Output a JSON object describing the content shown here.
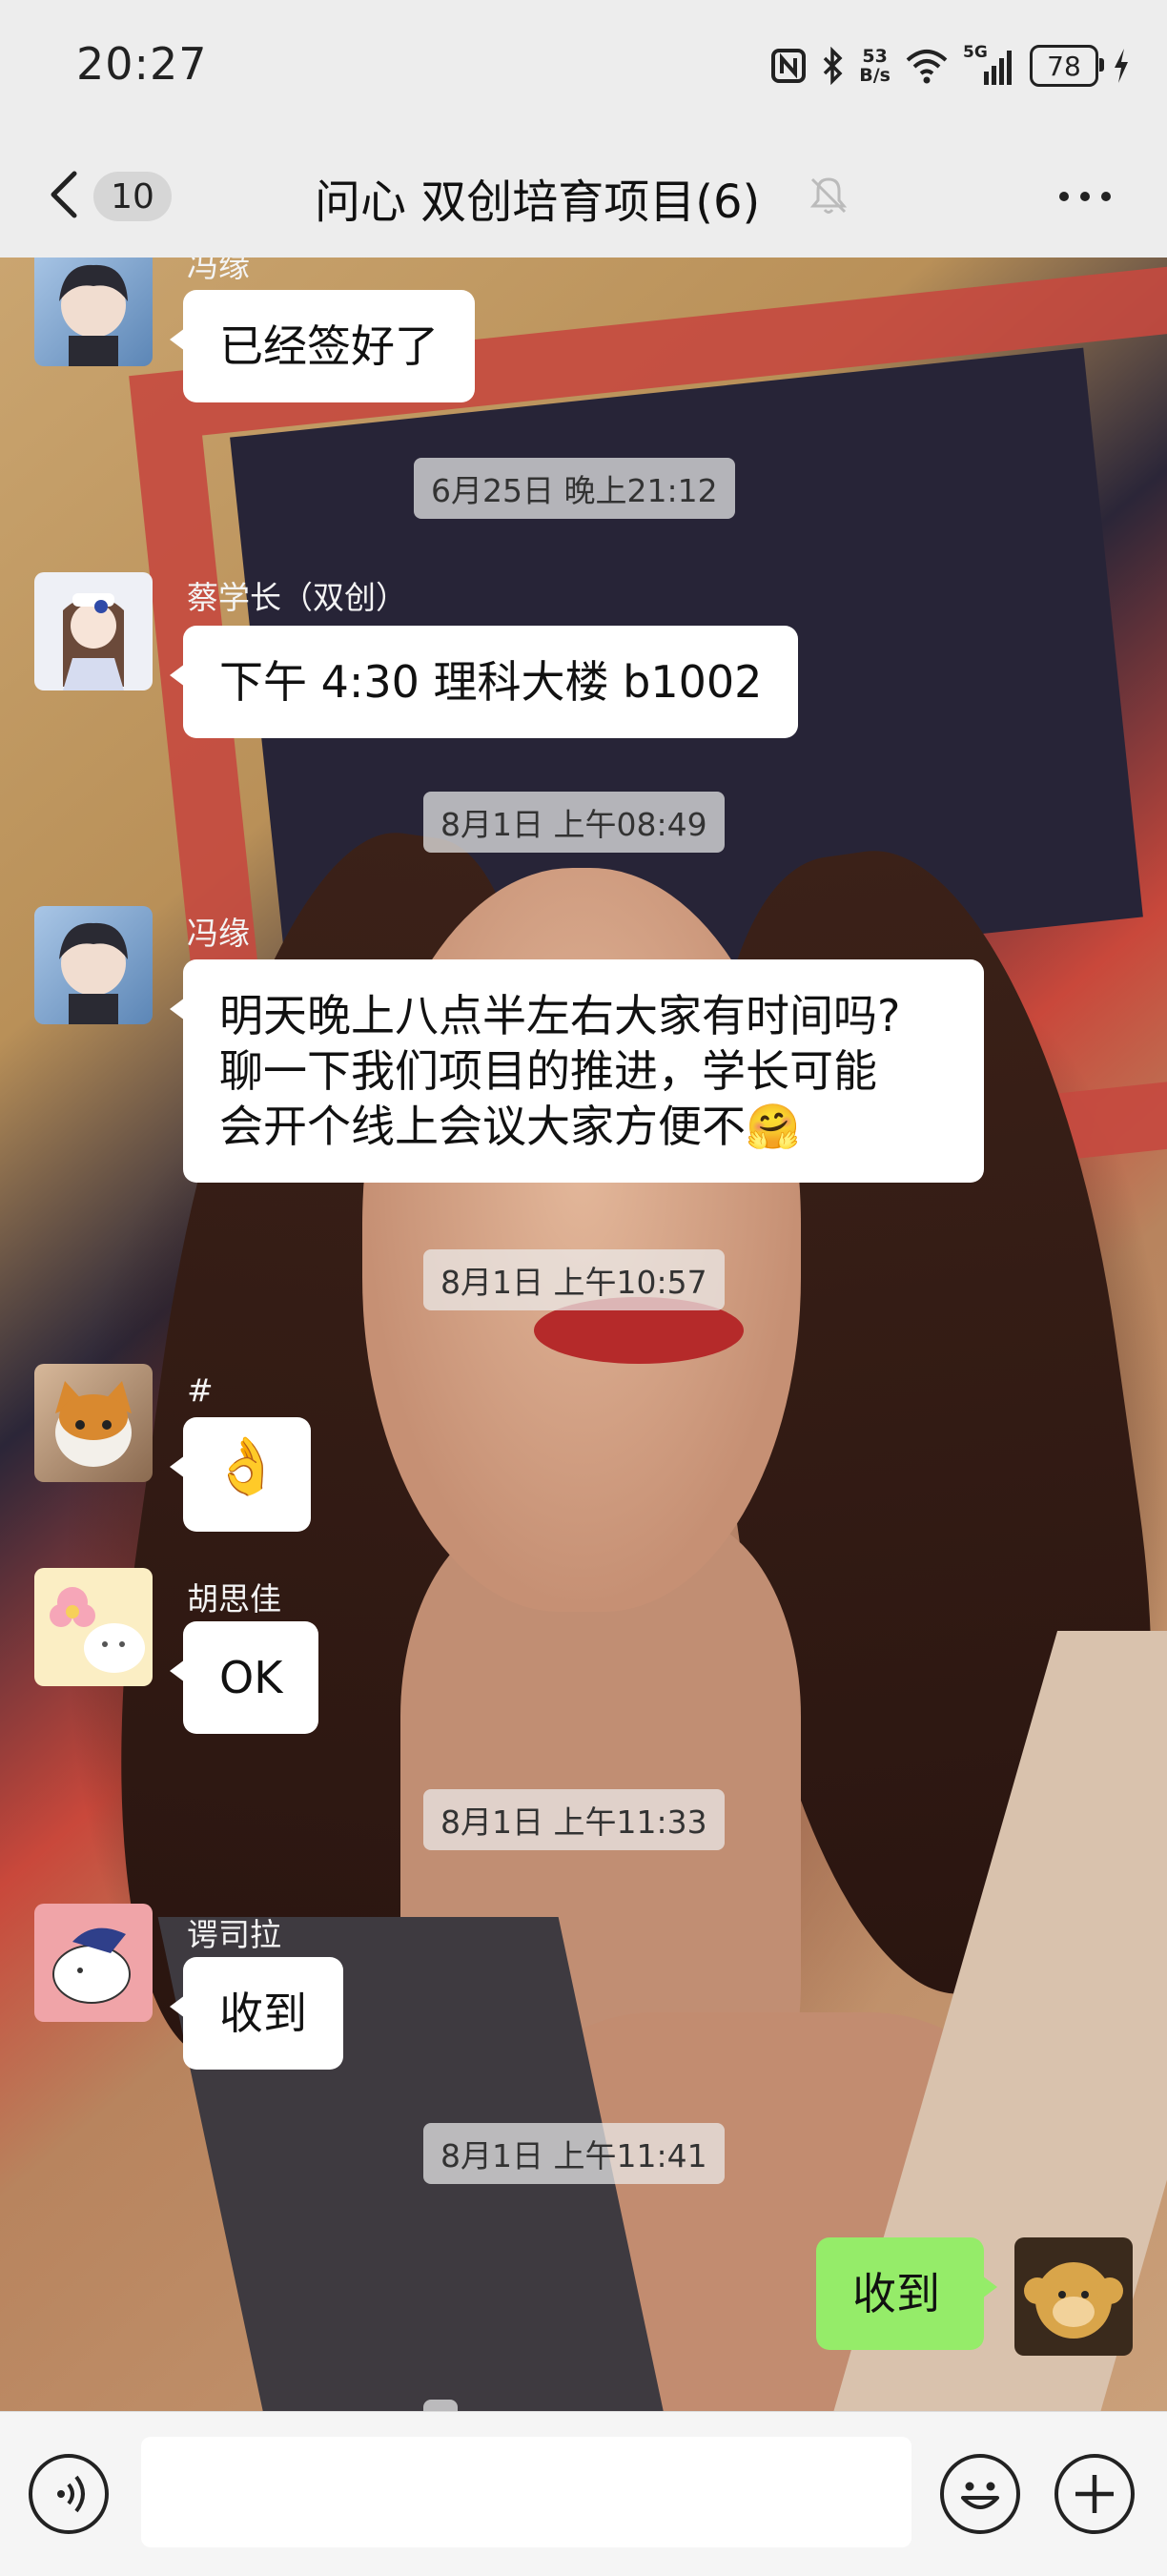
{
  "status_bar": {
    "time": "20:27",
    "net_speed_value": "53",
    "net_speed_unit": "B/s",
    "signal_label": "5G",
    "battery": "78",
    "icons": [
      "nfc-icon",
      "bluetooth-icon",
      "wifi-icon",
      "cell-signal-icon",
      "battery-icon",
      "charging-icon"
    ]
  },
  "nav": {
    "unread_count": "10",
    "title": "问心 双创培育项目(6)",
    "icons": [
      "back-icon",
      "mute-icon",
      "more-icon"
    ]
  },
  "messages": [
    {
      "sender": "冯缘",
      "text": "已经签好了"
    },
    {
      "timestamp": "6月25日 晚上21:12"
    },
    {
      "sender": "蔡学长（双创）",
      "text": "下午 4:30 理科大楼 b1002"
    },
    {
      "timestamp": "8月1日 上午08:49"
    },
    {
      "sender": "冯缘",
      "lines": [
        "明天晚上八点半左右大家有时间吗?",
        "聊一下我们项目的推进，学长可能",
        "会开个线上会议大家方便不"
      ],
      "emoji": "🤗"
    },
    {
      "timestamp": "8月1日 上午10:57"
    },
    {
      "sender": "#",
      "emoji": "👌"
    },
    {
      "sender": "胡思佳",
      "text": "OK"
    },
    {
      "timestamp": "8月1日 上午11:33"
    },
    {
      "sender": "谔司拉",
      "text": "收到"
    },
    {
      "timestamp": "8月1日 上午11:41"
    },
    {
      "sender": "me",
      "text": "收到"
    }
  ],
  "input": {
    "placeholder": "",
    "value": ""
  },
  "colors": {
    "bubble_mine": "#95ec69",
    "bubble_other": "#ffffff",
    "bar": "#ededed"
  }
}
